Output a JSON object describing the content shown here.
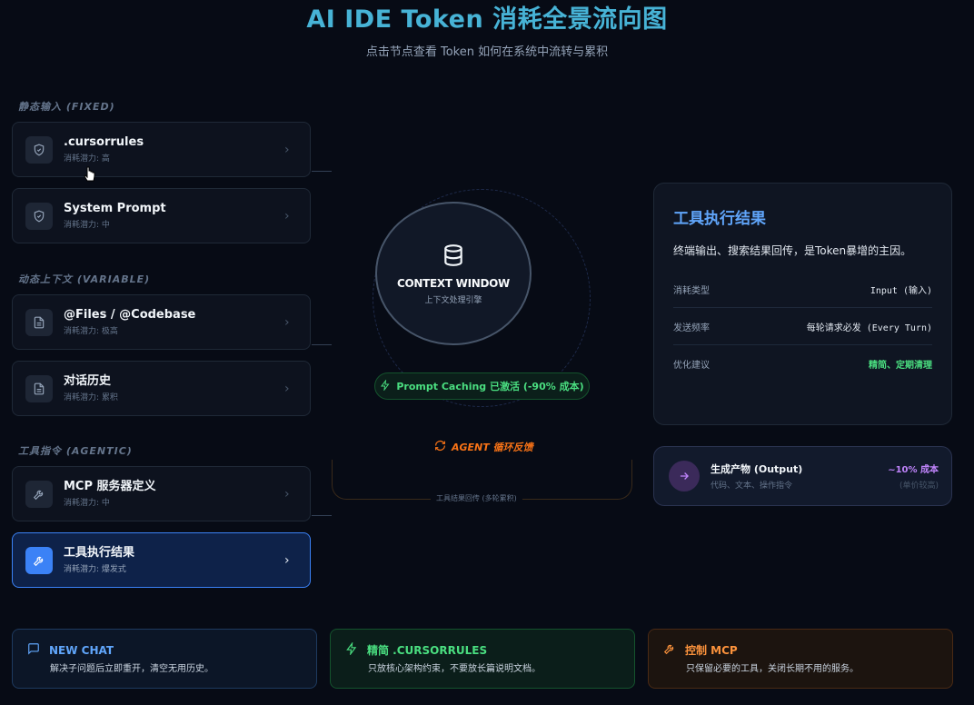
{
  "header": {
    "title": "AI IDE Token 消耗全景流向图",
    "subtitle": "点击节点查看 Token 如何在系统中流转与累积"
  },
  "sections": {
    "static": "静态输入 (FIXED)",
    "dynamic": "动态上下文 (VARIABLE)",
    "tools": "工具指令 (AGENTIC)"
  },
  "nodes": [
    {
      "name": ".cursorrules",
      "sub": "消耗潜力: 高",
      "icon": "shield-icon"
    },
    {
      "name": "System Prompt",
      "sub": "消耗潜力: 中",
      "icon": "shield-icon"
    },
    {
      "name": "@Files / @Codebase",
      "sub": "消耗潜力: 极高",
      "icon": "file-icon"
    },
    {
      "name": "对话历史",
      "sub": "消耗潜力: 累积",
      "icon": "file-icon"
    },
    {
      "name": "MCP 服务器定义",
      "sub": "消耗潜力: 中",
      "icon": "wrench-icon"
    },
    {
      "name": "工具执行结果",
      "sub": "消耗潜力: 爆发式",
      "icon": "wrench-icon",
      "active": true
    }
  ],
  "center": {
    "title": "CONTEXT WINDOW",
    "sub": "上下文处理引擎",
    "cache": "Prompt Caching 已激活 (-90% 成本)",
    "agent": "AGENT 循环反馈",
    "loop_label": "工具结果回传 (多轮累积)"
  },
  "detail": {
    "title": "工具执行结果",
    "desc": "终端输出、搜索结果回传，是Token暴增的主因。",
    "rows": [
      {
        "k": "消耗类型",
        "v": "Input (输入)"
      },
      {
        "k": "发送频率",
        "v": "每轮请求必发 (Every Turn)"
      },
      {
        "k": "优化建议",
        "v": "精简、定期清理"
      }
    ]
  },
  "output": {
    "name": "生成产物 (Output)",
    "sub": "代码、文本、操作指令",
    "cost": "~10% 成本",
    "note": "(单价较高)"
  },
  "tips": [
    {
      "title": "NEW CHAT",
      "desc": "解决子问题后立即重开，清空无用历史。"
    },
    {
      "title": "精简 .CURSORRULES",
      "desc": "只放核心架构约束，不要放长篇说明文档。"
    },
    {
      "title": "控制 MCP",
      "desc": "只保留必要的工具，关闭长期不用的服务。"
    }
  ],
  "colors": {
    "accent_blue": "#3b82f6",
    "accent_green": "#4ade80",
    "accent_orange": "#f97316",
    "accent_purple": "#c084fc",
    "title": "#47b3d6"
  }
}
